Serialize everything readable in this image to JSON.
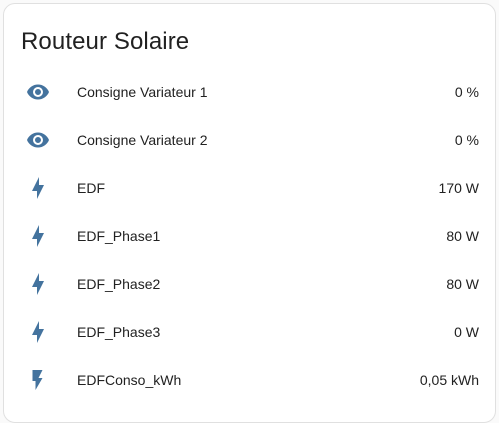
{
  "card": {
    "title": "Routeur Solaire",
    "icon_color": "#44739e",
    "entities": [
      {
        "icon": "eye-icon",
        "name": "Consigne Variateur 1",
        "state": "0 %"
      },
      {
        "icon": "eye-icon",
        "name": "Consigne Variateur 2",
        "state": "0 %"
      },
      {
        "icon": "lightning-bolt-icon",
        "name": "EDF",
        "state": "170 W"
      },
      {
        "icon": "lightning-bolt-icon",
        "name": "EDF_Phase1",
        "state": "80 W"
      },
      {
        "icon": "lightning-bolt-icon",
        "name": "EDF_Phase2",
        "state": "80 W"
      },
      {
        "icon": "lightning-bolt-icon",
        "name": "EDF_Phase3",
        "state": "0 W"
      },
      {
        "icon": "flash-icon",
        "name": "EDFConso_kWh",
        "state": "0,05 kWh"
      }
    ]
  }
}
